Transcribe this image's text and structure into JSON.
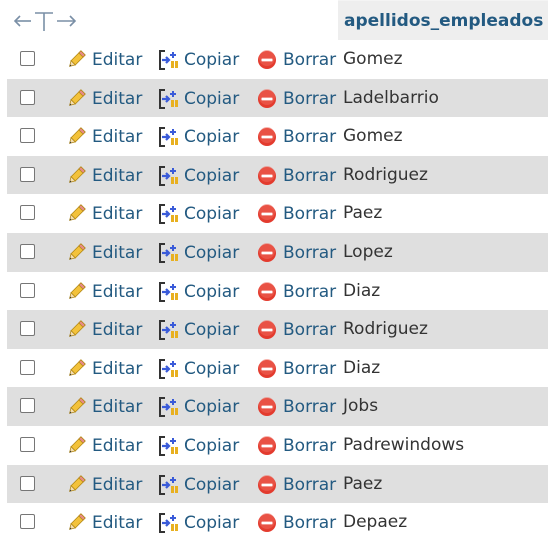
{
  "table": {
    "column_header": "apellidos_empleados",
    "actions": {
      "edit_label": "Editar",
      "copy_label": "Copiar",
      "delete_label": "Borrar"
    },
    "rows": [
      {
        "apellido": "Gomez",
        "selected": false
      },
      {
        "apellido": "Ladelbarrio",
        "selected": false
      },
      {
        "apellido": "Gomez",
        "selected": false
      },
      {
        "apellido": "Rodriguez",
        "selected": false
      },
      {
        "apellido": "Paez",
        "selected": false
      },
      {
        "apellido": "Lopez",
        "selected": false
      },
      {
        "apellido": "Diaz",
        "selected": false
      },
      {
        "apellido": "Rodriguez",
        "selected": false
      },
      {
        "apellido": "Diaz",
        "selected": false
      },
      {
        "apellido": "Jobs",
        "selected": false
      },
      {
        "apellido": "Padrewindows",
        "selected": false
      },
      {
        "apellido": "Paez",
        "selected": false
      },
      {
        "apellido": "Depaez",
        "selected": false
      }
    ]
  },
  "colors": {
    "link": "#235a81",
    "row_alt": "#dfdfdf",
    "header_bg": "#eeeeee",
    "delete_red": "#e33b2e",
    "pencil_yellow": "#f3c23a"
  },
  "icons": {
    "sort": "left-right-arrows-icon",
    "edit": "pencil-icon",
    "copy": "copy-insert-icon",
    "delete": "delete-circle-icon"
  }
}
